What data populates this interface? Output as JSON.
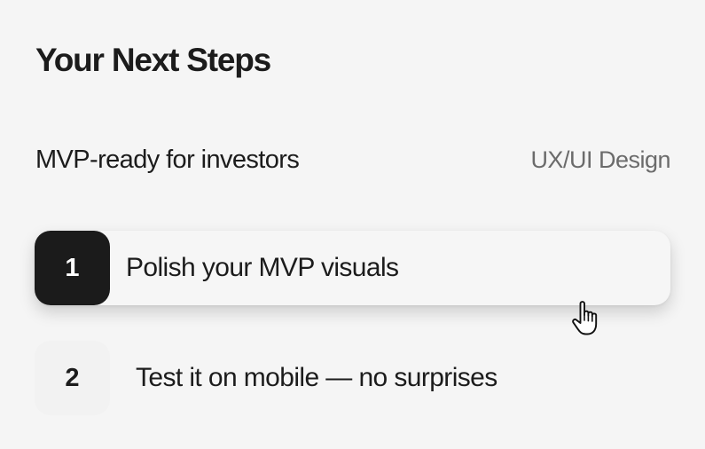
{
  "header": {
    "title": "Your Next Steps"
  },
  "project": {
    "name": "MVP-ready for investors",
    "tag": "UX/UI Design"
  },
  "steps": [
    {
      "number": "1",
      "label": "Polish your MVP visuals",
      "active": true
    },
    {
      "number": "2",
      "label": "Test it on mobile — no surprises",
      "active": false
    }
  ],
  "cursor": {
    "icon": "pointer-hand-icon"
  },
  "colors": {
    "background": "#f5f5f5",
    "active_badge": "#1b1b1b",
    "text": "#1c1c1c",
    "muted_text": "#6b6b6b"
  }
}
